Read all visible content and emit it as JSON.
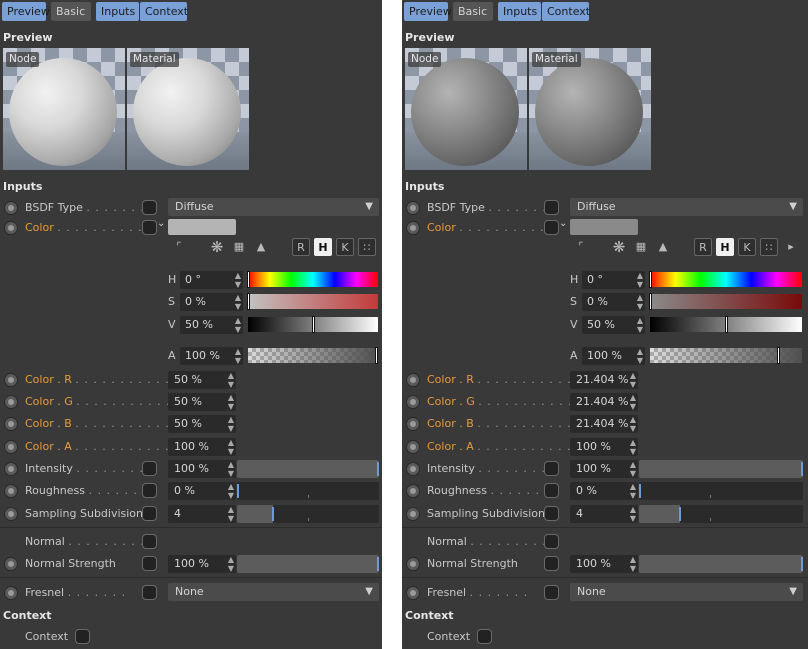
{
  "tabs": [
    "Preview",
    "Basic",
    "Inputs",
    "Context"
  ],
  "sections": {
    "preview": "Preview",
    "inputs": "Inputs",
    "context": "Context"
  },
  "previews": [
    "Node",
    "Material"
  ],
  "dots": {
    "bsdf": ". . . . . . .",
    "color": ". . . . . . . . . .",
    "channel": ". . . . . . . . . . .",
    "intensity": ". . . . . . . .",
    "roughness": ". . . . . . .",
    "normal": ". . . . . . . . ."
  },
  "labels": {
    "bsdf_type": "BSDF Type",
    "color": "Color",
    "color_r": "Color . R",
    "color_g": "Color . G",
    "color_b": "Color . B",
    "color_a": "Color . A",
    "intensity": "Intensity",
    "roughness": "Roughness",
    "sampling_subdivision": "Sampling Subdivision",
    "normal": "Normal",
    "normal_strength": "Normal Strength",
    "fresnel": "Fresnel",
    "context": "Context"
  },
  "color_tools": {
    "r": "R",
    "h": "H",
    "k": "K"
  },
  "channels": {
    "h": "H",
    "s": "S",
    "v": "V",
    "a": "A"
  },
  "left": {
    "bsdf_type": "Diffuse",
    "h": "0 °",
    "s": "0 %",
    "v": "50 %",
    "a": "100 %",
    "color_r": "50 %",
    "color_g": "50 %",
    "color_b": "50 %",
    "color_a": "100 %",
    "intensity": "100 %",
    "roughness": "0 %",
    "sampling_subdivision": "4",
    "normal_strength": "100 %",
    "fresnel": "None",
    "intensity_level": 1.0,
    "roughness_level": 0.0,
    "subdivision_level": 0.25,
    "normal_strength_level": 1.0,
    "v_level": 0.5
  },
  "right": {
    "bsdf_type": "Diffuse",
    "h": "0 °",
    "s": "0 %",
    "v": "50 %",
    "a": "100 %",
    "color_r": "21.404 %",
    "color_g": "21.404 %",
    "color_b": "21.404 %",
    "color_a": "100 %",
    "intensity": "100 %",
    "roughness": "0 %",
    "sampling_subdivision": "4",
    "normal_strength": "100 %",
    "fresnel": "None",
    "intensity_level": 1.0,
    "roughness_level": 0.0,
    "subdivision_level": 0.25,
    "normal_strength_level": 1.0,
    "v_level": 0.5
  },
  "colors": {
    "accent": "#7aa0d8",
    "label_orange": "#e89a3c",
    "panel_bg": "#393939",
    "swatch_left": "#b4b4b4",
    "swatch_right": "#8a8a8a"
  },
  "icons": [
    "chevron-down-icon",
    "picker-spiral-icon",
    "spectrum-icon",
    "image-icon",
    "eyedropper-icon"
  ]
}
